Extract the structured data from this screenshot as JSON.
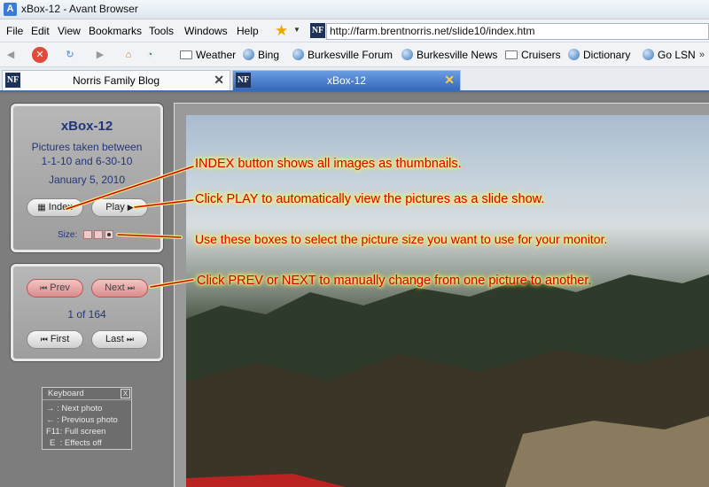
{
  "window": {
    "title": "xBox-12 - Avant Browser"
  },
  "menu": [
    "File",
    "Edit",
    "View",
    "Bookmarks",
    "Tools",
    "Windows",
    "Help"
  ],
  "address": {
    "url": "http://farm.brentnorris.net/slide10/index.htm",
    "logo": "NF"
  },
  "bookmarks": [
    {
      "label": "Weather",
      "icon": "folder-icon"
    },
    {
      "label": "Bing",
      "icon": "globe-icon"
    },
    {
      "label": "Burkesville Forum",
      "icon": "globe-icon"
    },
    {
      "label": "Burkesville News",
      "icon": "globe-icon"
    },
    {
      "label": "Cruisers",
      "icon": "folder-icon"
    },
    {
      "label": "Dictionary",
      "icon": "globe-icon"
    },
    {
      "label": "Go LSN",
      "icon": "globe-icon"
    }
  ],
  "tabs": [
    {
      "label": "Norris Family Blog",
      "active": false
    },
    {
      "label": "xBox-12",
      "active": true
    }
  ],
  "info_panel": {
    "title": "xBox-12",
    "line1": "Pictures taken between",
    "line2": "1-1-10 and 6-30-10",
    "date": "January 5, 2010",
    "index_label": "Index",
    "play_label": "Play",
    "size_label": "Size:"
  },
  "nav_panel": {
    "prev_label": "Prev",
    "next_label": "Next",
    "counter": "1 of 164",
    "first_label": "First",
    "last_label": "Last"
  },
  "keyboard": {
    "title": "Keyboard",
    "close": "X",
    "lines": [
      {
        "key": "→",
        "desc": ": Next photo"
      },
      {
        "key": "←",
        "desc": ": Previous photo"
      },
      {
        "key": "F11",
        "desc": ": Full screen"
      },
      {
        "key": "E",
        "desc": ": Effects off"
      }
    ]
  },
  "annotations": [
    "INDEX button shows all images as thumbnails.",
    "Click PLAY to automatically view the pictures as a slide show.",
    "Use these boxes to select the picture size you want to use for your monitor.",
    "Click PREV or NEXT to manually change from one picture to another."
  ],
  "colors": {
    "annotation_text": "#d40000",
    "annotation_glow": "#ffef6a",
    "panel_text": "#23367a",
    "active_tab": "#3568b9"
  }
}
